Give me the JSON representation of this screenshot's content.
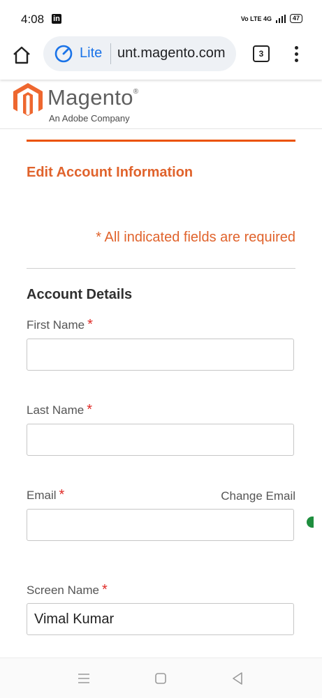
{
  "status_bar": {
    "time": "4:08",
    "notification_icon": "linkedin-icon",
    "network": "Vo LTE 4G",
    "battery": "47"
  },
  "browser": {
    "mode_label": "Lite",
    "url": "unt.magento.com",
    "tab_count": "3"
  },
  "site_header": {
    "logo_word": "Magento",
    "logo_registered": "®",
    "tagline": "An Adobe Company"
  },
  "page": {
    "heading": "Edit Account Information",
    "required_note": "* All indicated fields are required",
    "section_title": "Account Details",
    "required_mark": "*"
  },
  "fields": {
    "first_name": {
      "label": "First Name",
      "value": ""
    },
    "last_name": {
      "label": "Last Name",
      "value": ""
    },
    "email": {
      "label": "Email",
      "value": "",
      "change_link": "Change Email"
    },
    "screen_name": {
      "label": "Screen Name",
      "value": "Vimal Kumar"
    }
  },
  "colors": {
    "accent": "#e0632c",
    "rule": "#eb5202",
    "required_star": "#e02b27",
    "browser_blue": "#1a73e8"
  },
  "icons": {
    "home": "home-icon",
    "lite": "speedometer-icon",
    "menu": "more-vert-icon",
    "nav_recent": "recent-apps-icon",
    "nav_home": "home-square-icon",
    "nav_back": "back-triangle-icon"
  }
}
